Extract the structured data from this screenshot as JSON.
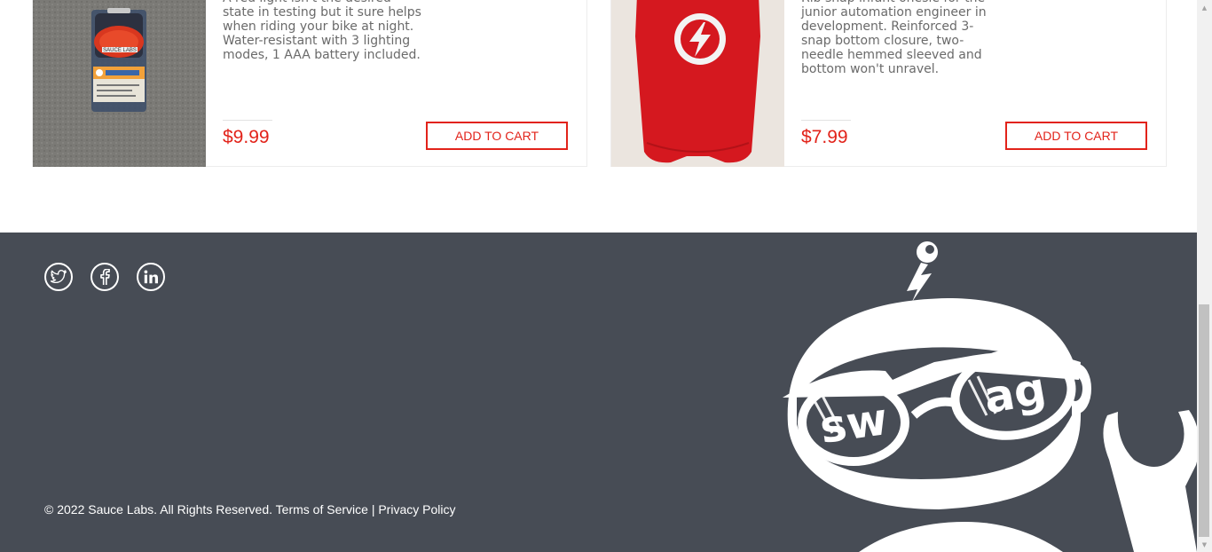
{
  "products": [
    {
      "description": "A red light isn't the desired state in testing but it sure helps when riding your bike at night. Water-resistant with 3 lighting modes, 1 AAA battery included.",
      "price": "$9.99",
      "button_label": "ADD TO CART",
      "image_text": "SAUCE LABS"
    },
    {
      "description": "Rib snap infant onesie for the junior automation engineer in development. Reinforced 3-snap bottom closure, two-needle hemmed sleeved and bottom won't unravel.",
      "price": "$7.99",
      "button_label": "ADD TO CART"
    }
  ],
  "footer": {
    "social": [
      "twitter-icon",
      "facebook-icon",
      "linkedin-icon"
    ],
    "copyright": "© 2022 Sauce Labs. All Rights Reserved.",
    "terms_link": "Terms of Service",
    "separator": "|",
    "privacy_link": "Privacy Policy",
    "robot_glasses_left": "sw",
    "robot_glasses_right": "ag"
  },
  "colors": {
    "accent": "#e2231a",
    "footer_bg": "#474c55"
  }
}
